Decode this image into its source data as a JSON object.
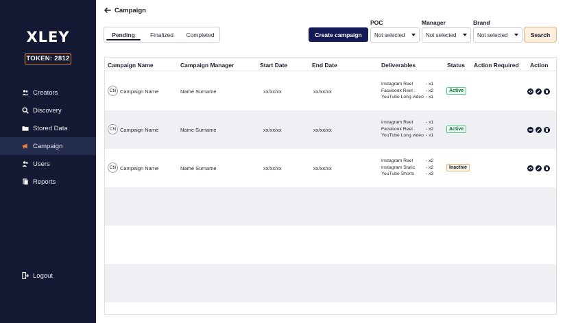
{
  "brand": {
    "logo": "XLEY",
    "token": "TOKEN: 2812"
  },
  "sidebar": {
    "items": [
      {
        "label": "Creators",
        "icon": "users-group-icon"
      },
      {
        "label": "Discovery",
        "icon": "discovery-search-icon"
      },
      {
        "label": "Stored Data",
        "icon": "folder-icon"
      },
      {
        "label": "Campaign",
        "icon": "megaphone-icon",
        "active": true
      },
      {
        "label": "Users",
        "icon": "users-icon"
      },
      {
        "label": "Reports",
        "icon": "reports-icon"
      }
    ],
    "logout": "Logout"
  },
  "header": {
    "back_title": "Campaign"
  },
  "tabs": [
    "Pending",
    "Finalized",
    "Completed"
  ],
  "create_button": "Create campaign",
  "filters": [
    {
      "label": "POC",
      "value": "Not selected"
    },
    {
      "label": "Manager",
      "value": "Not selected"
    },
    {
      "label": "Brand",
      "value": "Not selected"
    }
  ],
  "search_button": "Search",
  "table": {
    "columns": [
      "Campaign Name",
      "Campaign Manager",
      "Start Date",
      "End Date",
      "Deliverables",
      "Status",
      "Action Required",
      "Action"
    ],
    "rows": [
      {
        "initials": "CN",
        "name": "Campaign Name",
        "manager": "Name Surname",
        "start": "xx/xx/xx",
        "end": "xx/xx/xx",
        "deliverables": [
          {
            "item": "Instagram Reel",
            "qty": "- x1"
          },
          {
            "item": "Facebook Reel   .",
            "qty": "- x2"
          },
          {
            "item": "YouTube Long video",
            "qty": "- x1"
          }
        ],
        "status": "Active",
        "status_kind": "active"
      },
      {
        "initials": "CN",
        "name": "Campaign Name",
        "manager": "Name Surname",
        "start": "xx/xx/xx",
        "end": "xx/xx/xx",
        "deliverables": [
          {
            "item": "Instagram Reel",
            "qty": "- x1"
          },
          {
            "item": "Facebook Reel   .",
            "qty": "- x2"
          },
          {
            "item": "YouTube Long video",
            "qty": "- x1"
          }
        ],
        "status": "Active",
        "status_kind": "active"
      },
      {
        "initials": "CN",
        "name": "Campaign Name",
        "manager": "Name Surname",
        "start": "xx/xx/xx",
        "end": "xx/xx/xx",
        "deliverables": [
          {
            "item": "Instagram Reel",
            "qty": "- x2"
          },
          {
            "item": "Instagram Static",
            "qty": "- x2"
          },
          {
            "item": "YouTube Shorts",
            "qty": "- x3"
          }
        ],
        "status": "Inactive",
        "status_kind": "inactive"
      }
    ],
    "action_icons": [
      "view-icon",
      "edit-icon",
      "delete-icon"
    ]
  },
  "colors": {
    "sidebar_bg": "#141a33",
    "accent": "#e8863c",
    "primary_button": "#141a55",
    "active_status": "#5cc98a"
  }
}
